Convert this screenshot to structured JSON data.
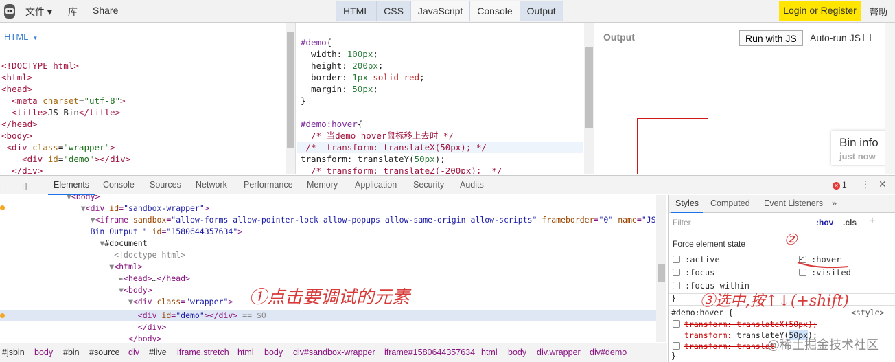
{
  "topbar": {
    "menu": [
      "文件 ▾",
      "库",
      "Share"
    ],
    "panels": [
      "HTML",
      "CSS",
      "JavaScript",
      "Console",
      "Output"
    ],
    "login": "Login or Register",
    "help": "帮助"
  },
  "html_panel": {
    "label": "HTML",
    "lines": [
      "<!DOCTYPE html>",
      "<html>",
      "<head>",
      "  <meta charset=\"utf-8\">",
      "  <title>JS Bin</title>",
      "</head>",
      "<body>",
      " <div class=\"wrapper\">",
      "    <div id=\"demo\"></div>",
      "  </div>",
      "</body>"
    ]
  },
  "css_panel": {
    "lines": [
      "#demo{",
      "  width: 100px;",
      "  height: 200px;",
      "  border: 1px solid red;",
      "  margin: 50px;",
      "}",
      "",
      "#demo:hover{",
      "  /* 当demo hover鼠标移上去时 */",
      " /*  transform: translateX(50px); */",
      "transform: translateY(50px);",
      "  /* transform: translateZ(-200px);  */",
      "}"
    ]
  },
  "output": {
    "label": "Output",
    "run_button": "Run with JS",
    "autorun": "Auto-run JS",
    "bin_info_title": "Bin info",
    "bin_info_sub": "just now"
  },
  "devtools": {
    "tabs": [
      "Elements",
      "Console",
      "Sources",
      "Network",
      "Performance",
      "Memory",
      "Application",
      "Security",
      "Audits"
    ],
    "error_count": "1",
    "elements_lines": [
      "▼<body>",
      "  ▼<div id=\"sandbox-wrapper\">",
      "    ▼<iframe sandbox=\"allow-forms allow-pointer-lock allow-popups allow-same-origin allow-scripts\" frameborder=\"0\" name=\"JS",
      "    Bin Output \" id=\"1580644357634\">",
      "      ▼#document",
      "          <!doctype html>",
      "        ▼<html>",
      "          ►<head>…</head>",
      "          ▼<body>",
      "            ▼<div class=\"wrapper\">",
      "                <div id=\"demo\"></div> == $0",
      "              </div>",
      "            </body>"
    ],
    "breadcrumbs": [
      "#jsbin",
      "body",
      "#bin",
      "#source",
      "div",
      "#live",
      "iframe.stretch",
      "html",
      "body",
      "div#sandbox-wrapper",
      "iframe#1580644357634",
      "html",
      "body",
      "div.wrapper",
      "div#demo"
    ],
    "styles": {
      "tabs": [
        "Styles",
        "Computed",
        "Event Listeners",
        "»"
      ],
      "filter_placeholder": "Filter",
      "hov": ":hov",
      "cls": ".cls",
      "force_title": "Force element state",
      "states": [
        ":active",
        ":focus",
        ":focus-within",
        ":hover",
        ":visited"
      ],
      "hover_checked": true,
      "rule_selector": "#demo:hover {",
      "rule_source": "<style>",
      "declarations": [
        "transform: translateX(50px);",
        "transform: translateY(50px);",
        "transform: translat"
      ]
    }
  },
  "annotations": {
    "step1": "①点击要调试的元素",
    "step2": "②",
    "step3": "③选中,按↑↓(+shift)"
  },
  "watermark": "@稀土掘金技术社区"
}
